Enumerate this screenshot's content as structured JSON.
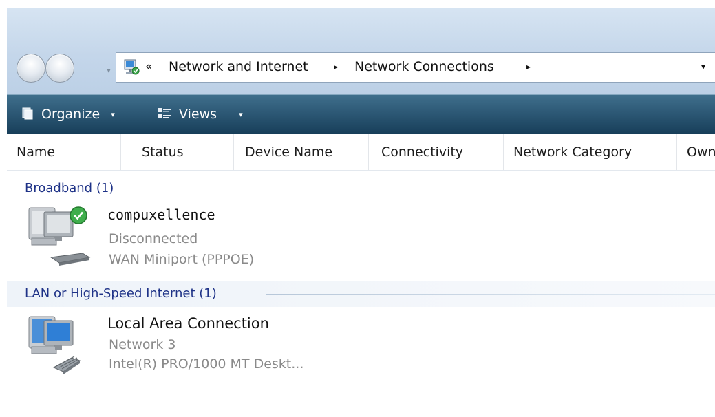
{
  "breadcrumb": {
    "overflow_glyph": "«",
    "items": [
      "Network and Internet",
      "Network Connections"
    ],
    "separator": "▸",
    "dropdown_glyph": "▾"
  },
  "toolbar": {
    "organize_label": "Organize",
    "views_label": "Views",
    "arrow_glyph": "▾"
  },
  "columns": [
    "Name",
    "Status",
    "Device Name",
    "Connectivity",
    "Network Category",
    "Owner"
  ],
  "groups": [
    {
      "title": "Broadband (1)",
      "items": [
        {
          "name": "compuxellence",
          "status": "Disconnected",
          "device": "WAN Miniport (PPPOE)",
          "icon": "broadband-connection-icon"
        }
      ]
    },
    {
      "title": "LAN or High-Speed Internet (1)",
      "items": [
        {
          "name": "Local Area Connection",
          "status": "Network 3",
          "device": "Intel(R) PRO/1000 MT Deskt...",
          "icon": "lan-connection-icon"
        }
      ]
    }
  ],
  "colors": {
    "toolbar_top": "#3f6f8c",
    "toolbar_bottom": "#173e59",
    "group_title": "#1e3287",
    "secondary_text": "#8a8a8a"
  }
}
